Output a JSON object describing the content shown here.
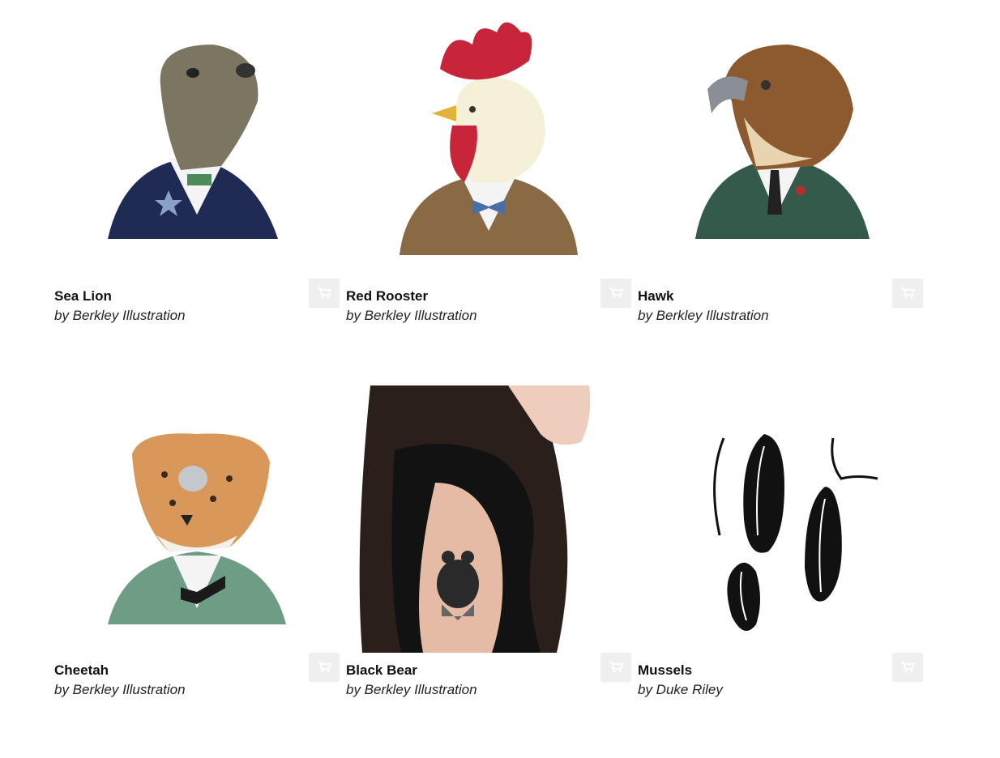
{
  "products": [
    {
      "title": "Sea Lion",
      "byline": "by Berkley Illustration",
      "image_icon": "sea-lion-illustration"
    },
    {
      "title": "Red Rooster",
      "byline": "by Berkley Illustration",
      "image_icon": "rooster-illustration"
    },
    {
      "title": "Hawk",
      "byline": "by Berkley Illustration",
      "image_icon": "hawk-illustration"
    },
    {
      "title": "Cheetah",
      "byline": "by Berkley Illustration",
      "image_icon": "cheetah-illustration"
    },
    {
      "title": "Black Bear",
      "byline": "by Berkley Illustration",
      "image_icon": "bear-tattoo-photo"
    },
    {
      "title": "Mussels",
      "byline": "by Duke Riley",
      "image_icon": "mussels-illustration"
    }
  ],
  "colors": {
    "cart_button_bg": "#efefef",
    "cart_icon": "#ffffff"
  }
}
